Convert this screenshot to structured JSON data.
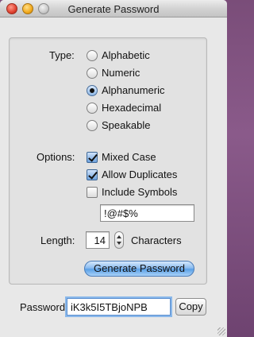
{
  "window": {
    "title": "Generate Password"
  },
  "type": {
    "label": "Type:",
    "options": [
      {
        "label": "Alphabetic",
        "selected": false
      },
      {
        "label": "Numeric",
        "selected": false
      },
      {
        "label": "Alphanumeric",
        "selected": true
      },
      {
        "label": "Hexadecimal",
        "selected": false
      },
      {
        "label": "Speakable",
        "selected": false
      }
    ]
  },
  "options": {
    "label": "Options:",
    "checkboxes": [
      {
        "label": "Mixed Case",
        "checked": true
      },
      {
        "label": "Allow Duplicates",
        "checked": true
      },
      {
        "label": "Include Symbols",
        "checked": false
      }
    ],
    "symbols_value": "!@#$%"
  },
  "length": {
    "label": "Length:",
    "value": "14",
    "unit": "Characters"
  },
  "generate_button": "Generate Password",
  "password": {
    "label": "Password",
    "value": "iK3k5I5TBjoNPB",
    "copy_button": "Copy"
  }
}
